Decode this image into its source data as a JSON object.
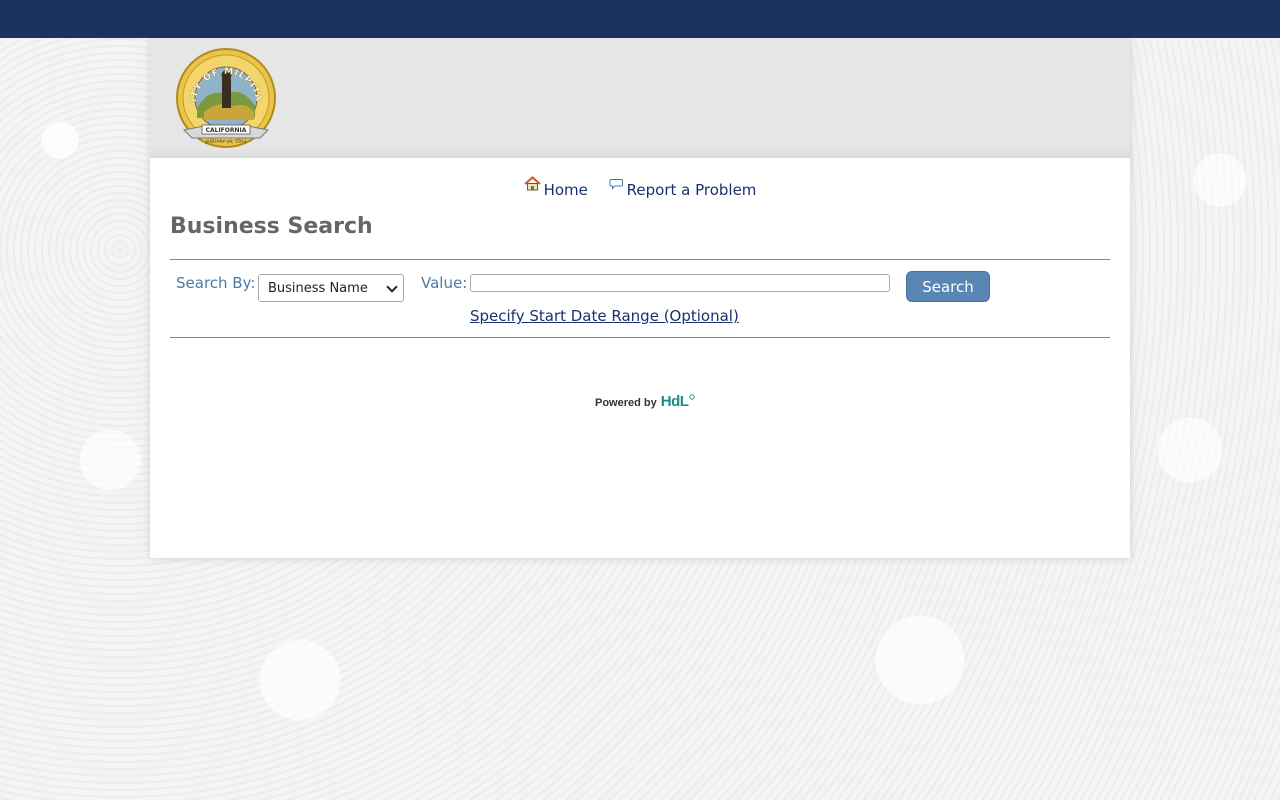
{
  "header": {
    "seal": {
      "text_top": "CITY OF MILPITAS",
      "banner": "CALIFORNIA",
      "date": "JANUARY 26, 1954"
    }
  },
  "nav": {
    "items": [
      {
        "label": "Home",
        "icon": "home-icon"
      },
      {
        "label": "Report a Problem",
        "icon": "speech-bubble-icon"
      }
    ]
  },
  "page": {
    "title": "Business Search"
  },
  "search": {
    "search_by_label": "Search By:",
    "search_by_selected": "Business Name",
    "value_label": "Value:",
    "value": "",
    "button_label": "Search",
    "date_range_link": "Specify Start Date Range (Optional)"
  },
  "footer": {
    "powered_by": "Powered by",
    "brand": "HdL"
  },
  "colors": {
    "topbar": "#1c325f",
    "link": "#1a2f6e",
    "label": "#4a7aa8",
    "button": "#5a86b6",
    "title": "#666666"
  }
}
